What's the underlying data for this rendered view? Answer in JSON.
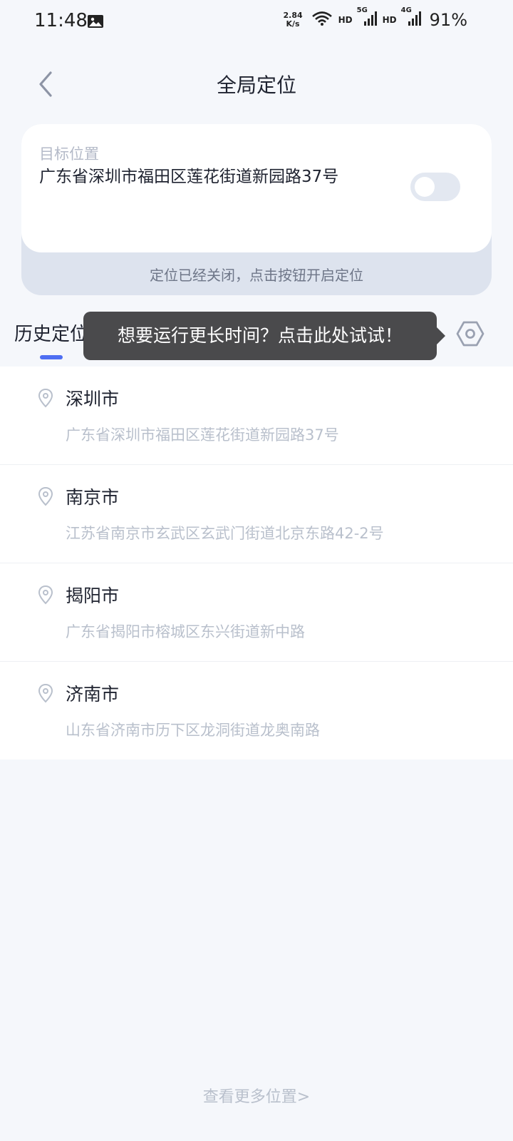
{
  "status_bar": {
    "time": "11:48",
    "net_speed_value": "2.84",
    "net_speed_unit": "K/s",
    "hd1": "HD",
    "sig1_label": "5G",
    "hd2": "HD",
    "sig2_label": "4G",
    "battery": "91%"
  },
  "header": {
    "title": "全局定位"
  },
  "target": {
    "label": "目标位置",
    "address": "广东省深圳市福田区莲花街道新园路37号",
    "toggle_on": false,
    "status_text": "定位已经关闭，点击按钮开启定位"
  },
  "tabs": {
    "history_label": "历史定位"
  },
  "tooltip": {
    "text": "想要运行更长时间？点击此处试试！"
  },
  "history": [
    {
      "city": "深圳市",
      "address": "广东省深圳市福田区莲花街道新园路37号"
    },
    {
      "city": "南京市",
      "address": "江苏省南京市玄武区玄武门街道北京东路42-2号"
    },
    {
      "city": "揭阳市",
      "address": "广东省揭阳市榕城区东兴街道新中路"
    },
    {
      "city": "济南市",
      "address": "山东省济南市历下区龙洞街道龙奥南路"
    }
  ],
  "footer": {
    "more_link": "查看更多位置>"
  },
  "colors": {
    "accent": "#4e6ef2",
    "background": "#f5f7fb",
    "tooltip_bg": "#4a4a4c"
  }
}
